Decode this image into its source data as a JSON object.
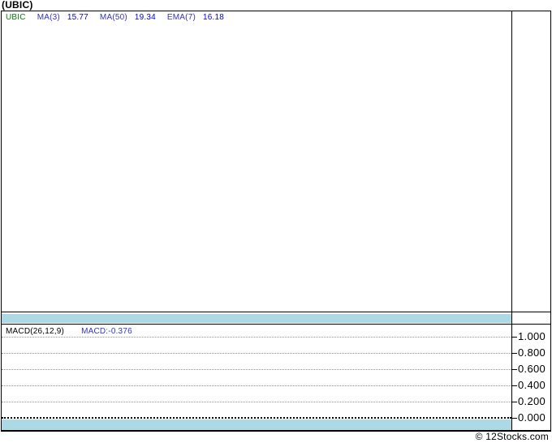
{
  "header": {
    "title": "(UBIC)"
  },
  "price_panel": {
    "legend": {
      "symbol": "UBIC",
      "items": [
        {
          "label": "MA(3)",
          "value": "15.77"
        },
        {
          "label": "MA(50)",
          "value": "19.34"
        },
        {
          "label": "EMA(7)",
          "value": "16.18"
        }
      ]
    }
  },
  "macd_panel": {
    "label": "MACD(26,12,9)",
    "value_label": "MACD:-0.376",
    "axis_labels": [
      "1.000",
      "0.800",
      "0.600",
      "0.400",
      "0.200",
      "0.000"
    ]
  },
  "footer": {
    "credit": "© 12Stocks.com"
  },
  "colors": {
    "symbol_green": "#077807",
    "legend_label_blue": "#3333bb",
    "legend_value_blue": "#0000ee",
    "macd_value_blue": "#3333cc",
    "band_blue": "#add8e6",
    "grid_gray": "#909090",
    "border_black": "#000000",
    "background": "#ffffff"
  },
  "chart_data": [
    {
      "type": "line",
      "title": "UBIC price panel",
      "series": [
        {
          "name": "UBIC",
          "values": []
        },
        {
          "name": "MA(3)",
          "last_value": 15.77,
          "values": []
        },
        {
          "name": "MA(50)",
          "last_value": 19.34,
          "values": []
        },
        {
          "name": "EMA(7)",
          "last_value": 16.18,
          "values": []
        }
      ],
      "legend_position": "top-left",
      "grid": false
    },
    {
      "type": "line",
      "title": "MACD(26,12,9)",
      "series": [
        {
          "name": "MACD",
          "last_value": -0.376,
          "values": []
        }
      ],
      "ylim": [
        0.0,
        1.0
      ],
      "yticks": [
        1.0,
        0.8,
        0.6,
        0.4,
        0.2,
        0.0
      ],
      "ytick_side": "right",
      "grid": true
    }
  ]
}
